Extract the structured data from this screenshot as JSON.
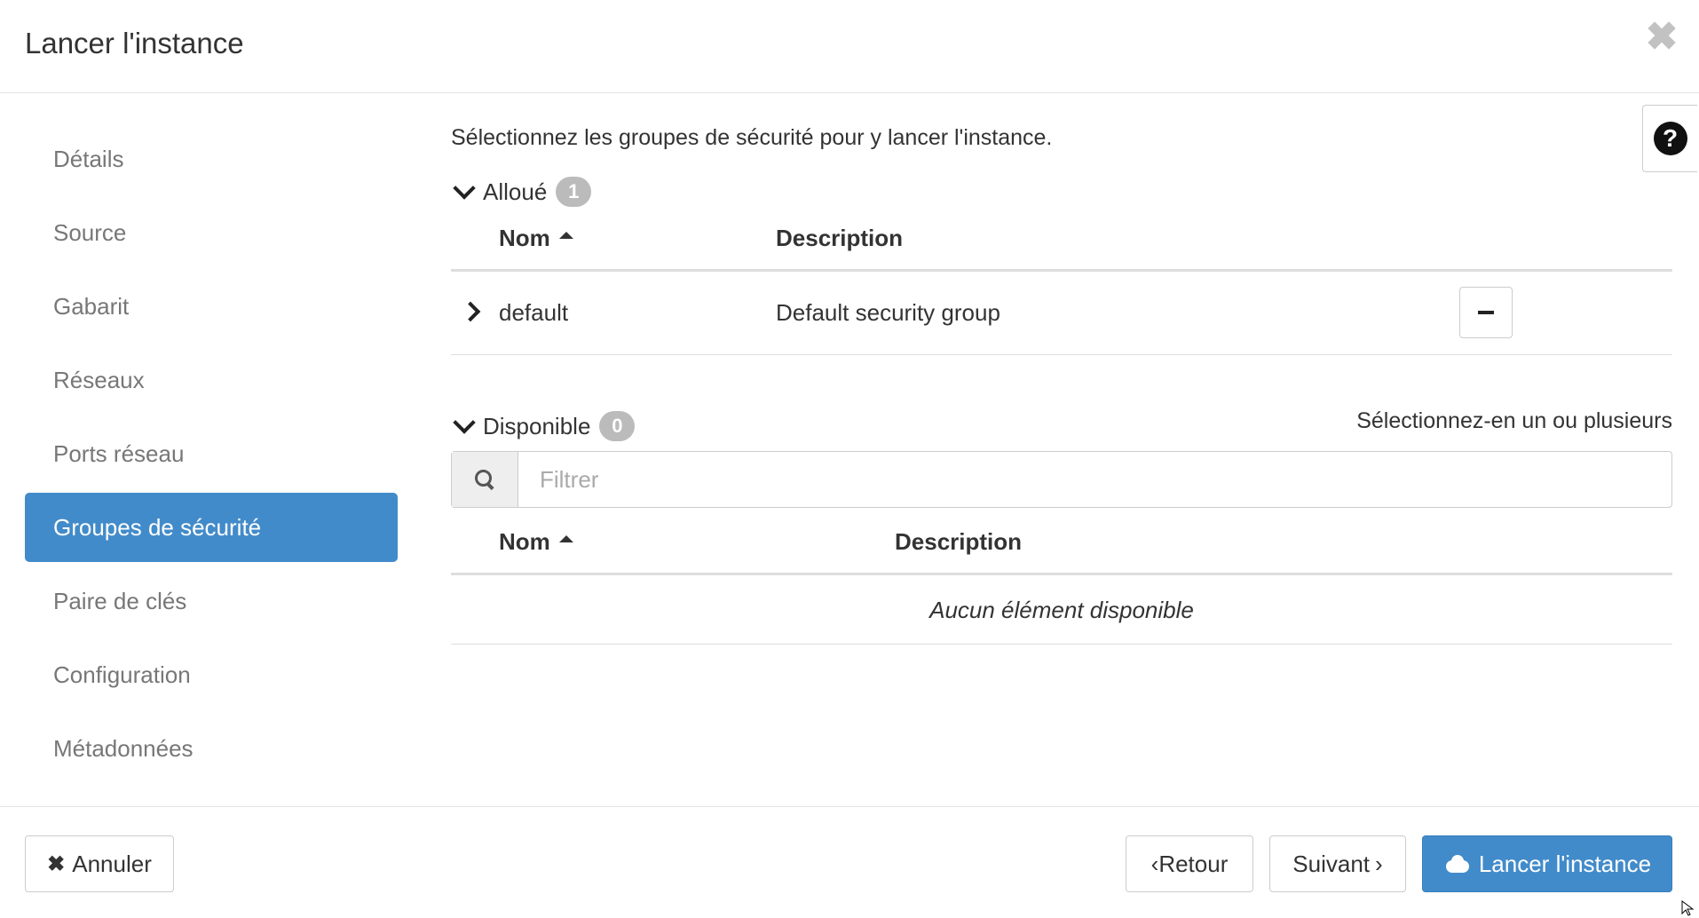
{
  "modal": {
    "title": "Lancer l'instance",
    "close_glyph": "✖"
  },
  "sidebar": {
    "items": [
      {
        "label": "Détails"
      },
      {
        "label": "Source"
      },
      {
        "label": "Gabarit"
      },
      {
        "label": "Réseaux"
      },
      {
        "label": "Ports réseau"
      },
      {
        "label": "Groupes de sécurité",
        "active": true
      },
      {
        "label": "Paire de clés"
      },
      {
        "label": "Configuration"
      },
      {
        "label": "Métadonnées"
      }
    ]
  },
  "help": {
    "glyph": "?"
  },
  "content": {
    "intro": "Sélectionnez les groupes de sécurité pour y lancer l'instance.",
    "allocated": {
      "label": "Alloué",
      "count": "1",
      "columns": {
        "name": "Nom",
        "description": "Description"
      },
      "rows": [
        {
          "name": "default",
          "description": "Default security group"
        }
      ]
    },
    "available": {
      "label": "Disponible",
      "count": "0",
      "hint": "Sélectionnez-en un ou plusieurs",
      "filter_placeholder": "Filtrer",
      "columns": {
        "name": "Nom",
        "description": "Description"
      },
      "empty_text": "Aucun élément disponible"
    }
  },
  "footer": {
    "cancel_label": "Annuler",
    "back_label": "Retour",
    "next_label": "Suivant",
    "launch_label": "Lancer l'instance"
  },
  "colors": {
    "accent": "#428bca",
    "badge": "#bbbbbb",
    "nav_text": "#777777"
  }
}
